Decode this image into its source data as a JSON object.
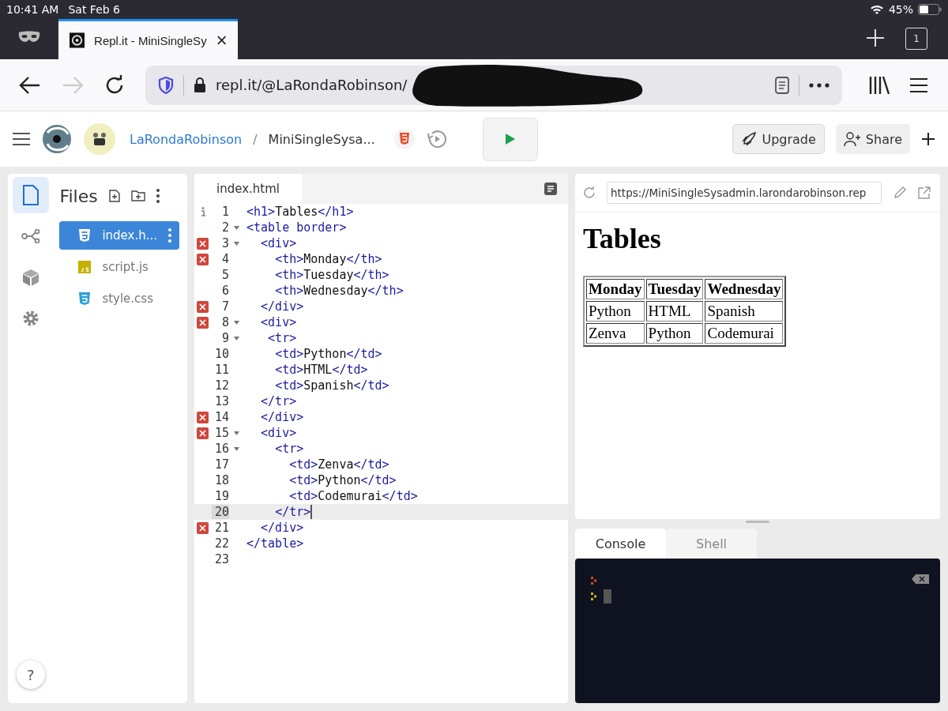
{
  "status_bar": {
    "time": "10:41 AM",
    "date": "Sat Feb 6",
    "battery": "45%"
  },
  "browser": {
    "tabs": [
      {
        "title": "Repl.it - MiniSingleSy",
        "selected": true
      }
    ],
    "tab_count": "1",
    "url": "repl.it/@LaRondaRobinson/"
  },
  "header": {
    "user": "LaRondaRobinson",
    "separator": "/",
    "repl_name": "MiniSingleSysa...",
    "buttons": [
      "Upgrade",
      "Share"
    ]
  },
  "sidebar": {
    "items": [
      {
        "selected": true
      },
      {
        "selected": false
      },
      {
        "selected": false
      },
      {
        "selected": false
      }
    ],
    "help": "?"
  },
  "files": {
    "title": "Files",
    "items": [
      {
        "name": "index.h...",
        "kind": "html",
        "selected": true
      },
      {
        "name": "script.js",
        "kind": "js",
        "selected": false
      },
      {
        "name": "style.css",
        "kind": "css",
        "selected": false
      }
    ]
  },
  "editor": {
    "tab": "index.html",
    "lines": [
      {
        "number": "1",
        "code": "<h1>Tables</h1>",
        "info": true,
        "error": false,
        "foldable": false,
        "active": false
      },
      {
        "number": "2",
        "code": "<table border>",
        "info": false,
        "error": false,
        "foldable": true,
        "active": false
      },
      {
        "number": "3",
        "code": "  <div>",
        "info": false,
        "error": true,
        "foldable": true,
        "active": false
      },
      {
        "number": "4",
        "code": "    <th>Monday</th>",
        "info": false,
        "error": true,
        "foldable": false,
        "active": false
      },
      {
        "number": "5",
        "code": "    <th>Tuesday</th>",
        "info": false,
        "error": false,
        "foldable": false,
        "active": false
      },
      {
        "number": "6",
        "code": "    <th>Wednesday</th>",
        "info": false,
        "error": false,
        "foldable": false,
        "active": false
      },
      {
        "number": "7",
        "code": "  </div>",
        "info": false,
        "error": true,
        "foldable": false,
        "active": false
      },
      {
        "number": "8",
        "code": "  <div>",
        "info": false,
        "error": true,
        "foldable": true,
        "active": false
      },
      {
        "number": "9",
        "code": "   <tr>",
        "info": false,
        "error": false,
        "foldable": true,
        "active": false
      },
      {
        "number": "10",
        "code": "    <td>Python</td>",
        "info": false,
        "error": false,
        "foldable": false,
        "active": false
      },
      {
        "number": "11",
        "code": "    <td>HTML</td>",
        "info": false,
        "error": false,
        "foldable": false,
        "active": false
      },
      {
        "number": "12",
        "code": "    <td>Spanish</td>",
        "info": false,
        "error": false,
        "foldable": false,
        "active": false
      },
      {
        "number": "13",
        "code": "  </tr>",
        "info": false,
        "error": false,
        "foldable": false,
        "active": false
      },
      {
        "number": "14",
        "code": "  </div>",
        "info": false,
        "error": true,
        "foldable": false,
        "active": false
      },
      {
        "number": "15",
        "code": "  <div>",
        "info": false,
        "error": true,
        "foldable": true,
        "active": false
      },
      {
        "number": "16",
        "code": "    <tr>",
        "info": false,
        "error": false,
        "foldable": true,
        "active": false
      },
      {
        "number": "17",
        "code": "      <td>Zenva</td>",
        "info": false,
        "error": false,
        "foldable": false,
        "active": false
      },
      {
        "number": "18",
        "code": "      <td>Python</td>",
        "info": false,
        "error": false,
        "foldable": false,
        "active": false
      },
      {
        "number": "19",
        "code": "      <td>Codemurai</td>",
        "info": false,
        "error": false,
        "foldable": false,
        "active": false
      },
      {
        "number": "20",
        "code": "    </tr>",
        "info": false,
        "error": false,
        "foldable": false,
        "active": true
      },
      {
        "number": "21",
        "code": "  </div>",
        "info": false,
        "error": true,
        "foldable": false,
        "active": false
      },
      {
        "number": "22",
        "code": "</table>",
        "info": false,
        "error": false,
        "foldable": false,
        "active": false
      },
      {
        "number": "23",
        "info": false,
        "error": false,
        "foldable": false,
        "active": false
      }
    ]
  },
  "preview": {
    "url": "https://MiniSingleSysadmin.larondarobinson.rep",
    "heading": "Tables",
    "table": {
      "header": [
        "Monday",
        "Tuesday",
        "Wednesday"
      ],
      "rows": [
        [
          "Python",
          "HTML",
          "Spanish"
        ],
        [
          "Zenva",
          "Python",
          "Codemurai"
        ]
      ]
    }
  },
  "console": {
    "tabs": [
      {
        "label": "Console",
        "selected": true
      },
      {
        "label": "Shell",
        "selected": false
      }
    ]
  }
}
